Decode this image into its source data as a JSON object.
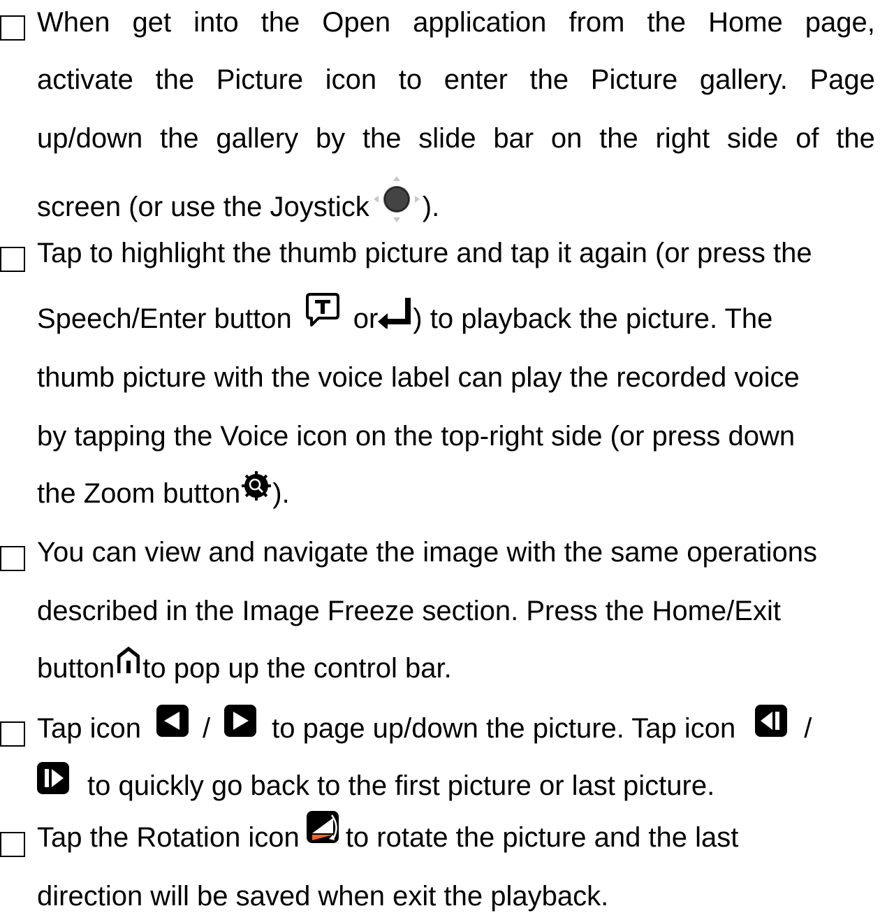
{
  "bullets": [
    {
      "lines": [
        [
          "When",
          "get",
          "into",
          "the",
          "Open",
          "application",
          "from",
          "the",
          "Home",
          "page,"
        ],
        [
          "activate",
          "the",
          "Picture",
          "icon",
          "to",
          "enter",
          "the",
          "Picture",
          "gallery.",
          "Page"
        ],
        [
          "up/down",
          "the",
          "gallery",
          "by",
          "the",
          "slide",
          "bar",
          "on",
          "the",
          "right",
          "side",
          "of",
          "the"
        ]
      ],
      "tail": {
        "before": "screen (or use the Joystick",
        "after": ")."
      }
    },
    {
      "line1": "Tap to highlight the thumb picture and tap it again (or press the",
      "line2": {
        "a": "Speech/Enter button",
        "b": "or",
        "c": ") to playback the picture. The"
      },
      "line3": "thumb picture with the voice label can play the recorded voice",
      "line4": "by tapping the Voice icon on the top-right side (or press down",
      "line5": {
        "a": "the Zoom button",
        "b": ")."
      }
    },
    {
      "line1": "You can view and navigate the image with the same operations",
      "line2": "described in the Image Freeze section. Press the Home/Exit",
      "line3": {
        "a": "button",
        "b": "to pop up the control bar."
      }
    },
    {
      "line1": {
        "a": "Tap icon",
        "sep1": "/",
        "b": "to page up/down the picture. Tap icon",
        "sep2": "/"
      },
      "line2": "to quickly go back to the first picture or last picture."
    },
    {
      "line1": {
        "a": "Tap the Rotation icon",
        "b": "to rotate the picture and the last"
      },
      "line2": "direction will be saved when exit the playback."
    }
  ],
  "icons": {
    "joystick": "joystick-icon",
    "speech": "speech-T-icon",
    "enter": "enter-arrow-icon",
    "zoom": "zoom-gear-icon",
    "home": "home-icon",
    "prev": "page-up-triangle-icon",
    "next": "page-down-triangle-icon",
    "first": "first-picture-icon",
    "last": "last-picture-icon",
    "rotation": "rotation-icon"
  },
  "colors": {
    "text": "#000000",
    "rotation_orange": "#f26522",
    "icon_gray": "#c8c8c8"
  }
}
